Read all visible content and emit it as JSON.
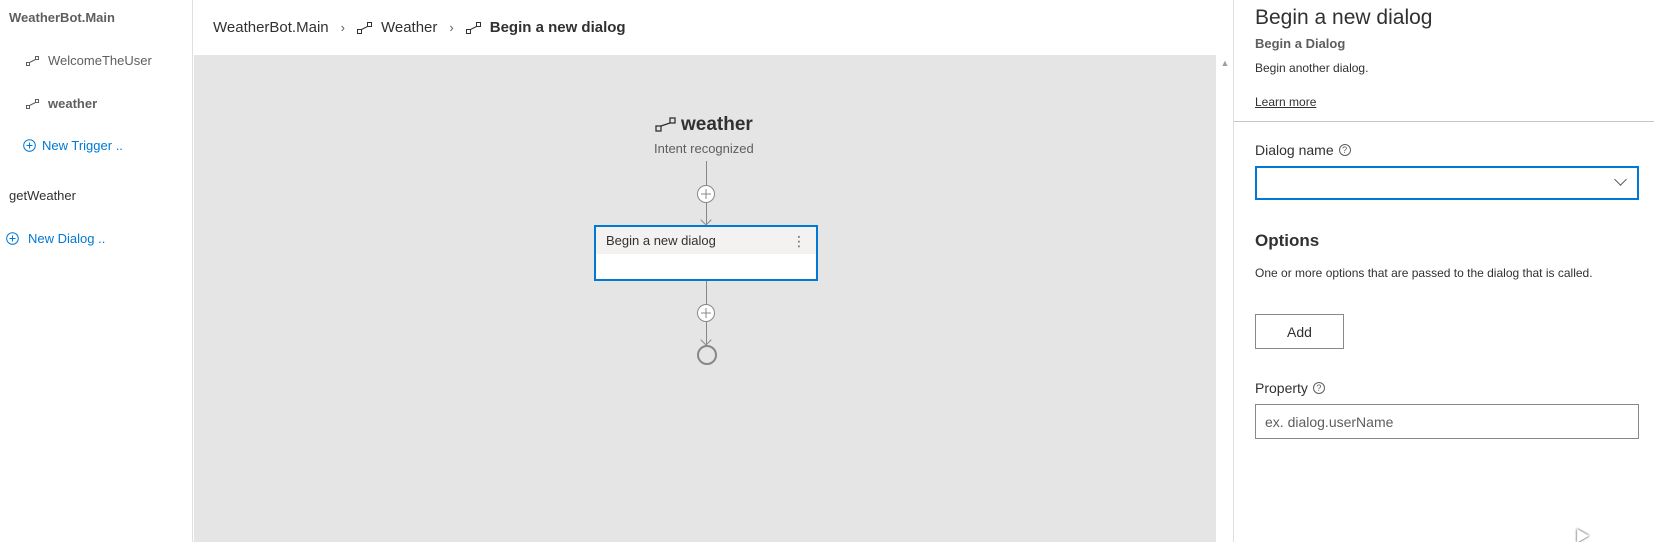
{
  "sidebar": {
    "main_dialog": "WeatherBot.Main",
    "triggers": [
      {
        "label": "WelcomeTheUser"
      },
      {
        "label": "weather"
      }
    ],
    "new_trigger": "New Trigger ..",
    "second_dialog": "getWeather",
    "new_dialog": "New Dialog .."
  },
  "breadcrumb": {
    "items": [
      "WeatherBot.Main",
      "Weather",
      "Begin a new dialog"
    ]
  },
  "canvas": {
    "trigger_title": "weather",
    "trigger_subtitle": "Intent recognized",
    "action_title": "Begin a new dialog"
  },
  "panel": {
    "title": "Begin a new dialog",
    "subtitle": "Begin a Dialog",
    "description": "Begin another dialog.",
    "learn_more": "Learn more",
    "dialog_name_label": "Dialog name",
    "dialog_name_value": "",
    "options_heading": "Options",
    "options_description": "One or more options that are passed to the dialog that is called.",
    "add_label": "Add",
    "property_label": "Property",
    "property_placeholder": "ex. dialog.userName"
  },
  "colors": {
    "accent": "#0078d4",
    "canvas_bg": "#e5e5e5"
  }
}
